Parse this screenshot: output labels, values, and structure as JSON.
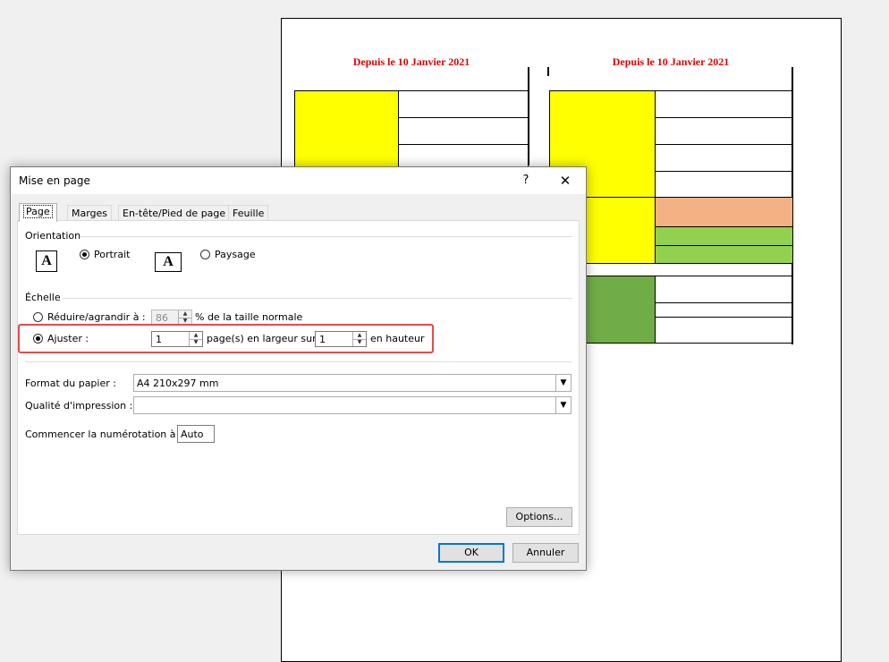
{
  "sheet": {
    "header_left": "Depuis le 10 Janvier 2021",
    "header_right": "Depuis le 10 Janvier 2021",
    "colors": {
      "yellow": "#ffff00",
      "orange": "#f4b183",
      "light_green": "#92d050",
      "dark_green": "#70ad47",
      "header_text": "#e00000"
    }
  },
  "dialog": {
    "title": "Mise en page",
    "help_label": "?",
    "close_label": "✕",
    "tabs": [
      {
        "label": "Page",
        "active": true
      },
      {
        "label": "Marges",
        "active": false
      },
      {
        "label": "En-tête/Pied de page",
        "active": false
      },
      {
        "label": "Feuille",
        "active": false
      }
    ],
    "orientation": {
      "group_label": "Orientation",
      "portrait_label": "Portrait",
      "paysage_label": "Paysage",
      "icon_letter": "A",
      "selected": "portrait"
    },
    "scale": {
      "group_label": "Échelle",
      "reduce_label": "Réduire/agrandir à :",
      "reduce_value": "86",
      "reduce_suffix": "% de la taille normale",
      "fit_label": "Ajuster :",
      "fit_width_value": "1",
      "fit_middle_label": "page(s) en largeur sur",
      "fit_height_value": "1",
      "fit_suffix": "en hauteur",
      "selected": "fit"
    },
    "paper": {
      "label": "Format du papier :",
      "value": "A4 210x297 mm"
    },
    "quality": {
      "label": "Qualité d'impression :",
      "value": ""
    },
    "numbering": {
      "label": "Commencer la numérotation à :",
      "value": "Auto"
    },
    "options_label": "Options...",
    "ok_label": "OK",
    "cancel_label": "Annuler",
    "highlight_color": "#e04e4e"
  }
}
